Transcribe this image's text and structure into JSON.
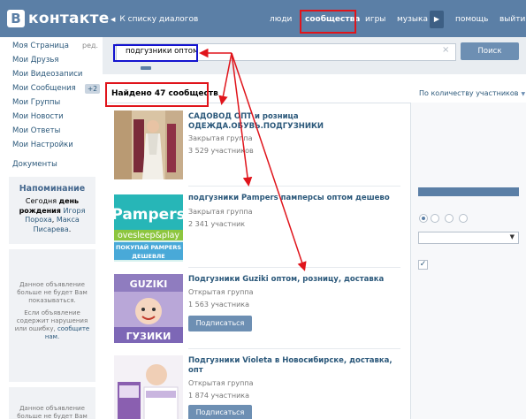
{
  "header": {
    "logo_letter": "В",
    "logo_text": "контакте",
    "back_link": "К списку диалогов",
    "nav": [
      "люди",
      "сообщества",
      "игры",
      "музыка",
      "помощь",
      "выйти"
    ],
    "active_nav": "сообщества"
  },
  "sidebar": {
    "items": [
      {
        "label": "Моя Страница"
      },
      {
        "label": "Мои Друзья"
      },
      {
        "label": "Мои Видеозаписи"
      },
      {
        "label": "Мои Сообщения"
      },
      {
        "label": "Мои Группы"
      },
      {
        "label": "Мои Новости"
      },
      {
        "label": "Мои Ответы"
      },
      {
        "label": "Мои Настройки"
      }
    ],
    "edit_label": "ред.",
    "messages_badge": "+2",
    "documents": "Документы"
  },
  "reminder": {
    "title": "Напоминание",
    "text_1": "Сегодня ",
    "text_2": "день рождения",
    "name_1": "Игоря Пороха",
    "text_3": ", ",
    "name_2": "Макса Писарева",
    "text_4": "."
  },
  "ads": [
    {
      "text_1": "Данное объявление больше не будет Вам показываться.",
      "text_2": "Если объявление содержит нарушения или ошибку,",
      "link": "сообщите нам."
    },
    {
      "text_1": "Данное объявление больше не будет Вам"
    }
  ],
  "search": {
    "value": "подгузники оптом",
    "button": "Поиск",
    "clear_icon": "×"
  },
  "results": {
    "found": "Найдено 47 сообществ",
    "sort": "По количеству участников",
    "groups": [
      {
        "title": "САДОВОД ОПТ и розница ОДЕЖДА.ОБУВЬ.ПОДГУЗНИКИ",
        "type": "Закрытая группа",
        "members": "3 529 участников",
        "has_button": false
      },
      {
        "title": "подгузники Pampers памперсы оптом дешево",
        "type": "Закрытая группа",
        "members": "2 341 участник",
        "has_button": false,
        "thumb_brand": "Pampers",
        "thumb_line_1": "ovesleep&play",
        "thumb_line_2": "ПОКУПАЙ PAMPERS",
        "thumb_line_3": "ДЕШЕВЛЕ"
      },
      {
        "title": "Подгузники Guziki оптом, розницу, доставка",
        "type": "Открытая группа",
        "members": "1 563 участника",
        "has_button": true,
        "button": "Подписаться",
        "thumb_brand": "GUZIKI",
        "thumb_brand_2": "ГУЗИКИ"
      },
      {
        "title": "Подгузники Violeta в Новосибирске, доставка, опт",
        "type": "Открытая группа",
        "members": "1 874 участника",
        "has_button": true,
        "button": "Подписаться"
      }
    ]
  },
  "colors": {
    "header": "#5b7fa6",
    "link": "#2b587a",
    "annotation_red": "#e0141b",
    "annotation_blue": "#1414cf"
  }
}
